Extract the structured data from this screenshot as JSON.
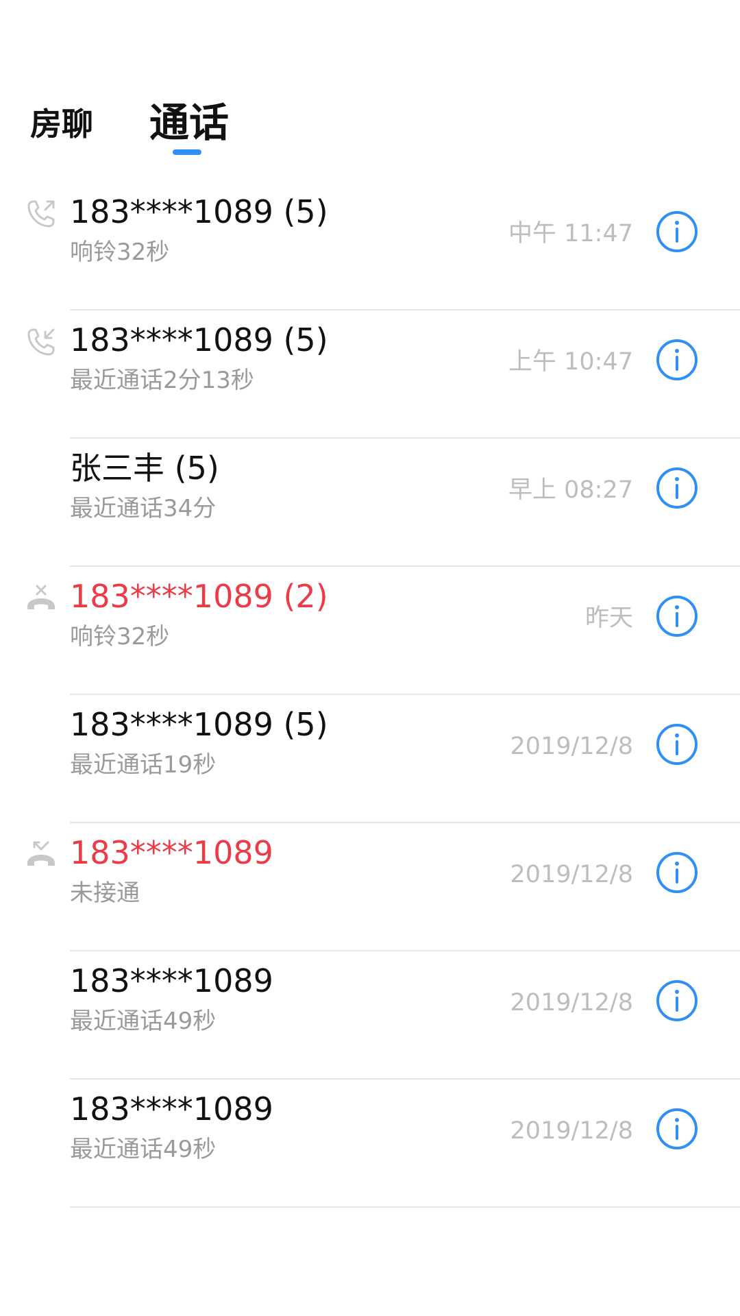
{
  "tabs": {
    "left_label": "房聊",
    "right_label": "通话",
    "active": "right"
  },
  "colors": {
    "accent": "#2f8ff5",
    "missed": "#ec3b46",
    "subtext": "#9a9a9a",
    "time": "#bdbdbd"
  },
  "calls": [
    {
      "title": "183****1089 (5)",
      "subtitle": "响铃32秒",
      "time": "中午 11:47",
      "icon": "outgoing-call-icon",
      "missed": false
    },
    {
      "title": "183****1089 (5)",
      "subtitle": "最近通话2分13秒",
      "time": "上午 10:47",
      "icon": "incoming-call-icon",
      "missed": false
    },
    {
      "title": "张三丰 (5)",
      "subtitle": "最近通话34分",
      "time": "早上 08:27",
      "icon": "",
      "missed": false
    },
    {
      "title": "183****1089 (2)",
      "subtitle": "响铃32秒",
      "time": "昨天",
      "icon": "canceled-call-icon",
      "missed": true
    },
    {
      "title": "183****1089 (5)",
      "subtitle": "最近通话19秒",
      "time": "2019/12/8",
      "icon": "",
      "missed": false
    },
    {
      "title": "183****1089",
      "subtitle": "未接通",
      "time": "2019/12/8",
      "icon": "missed-call-icon",
      "missed": true
    },
    {
      "title": "183****1089",
      "subtitle": "最近通话49秒",
      "time": "2019/12/8",
      "icon": "",
      "missed": false
    },
    {
      "title": "183****1089",
      "subtitle": "最近通话49秒",
      "time": "2019/12/8",
      "icon": "",
      "missed": false
    }
  ]
}
